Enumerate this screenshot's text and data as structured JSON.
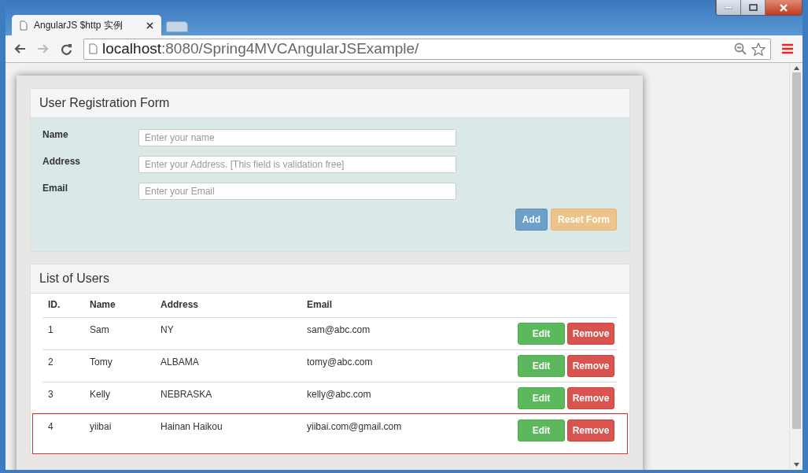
{
  "browser": {
    "tab_title": "AngularJS $http 实例",
    "address_host": "localhost",
    "address_path": ":8080/Spring4MVCAngularJSExample/"
  },
  "form": {
    "title": "User Registration Form",
    "fields": [
      {
        "label": "Name",
        "placeholder": "Enter your name"
      },
      {
        "label": "Address",
        "placeholder": "Enter your Address. [This field is validation free]"
      },
      {
        "label": "Email",
        "placeholder": "Enter your Email"
      }
    ],
    "buttons": [
      {
        "label": "Add",
        "kind": "primary"
      },
      {
        "label": "Reset Form",
        "kind": "warning"
      }
    ]
  },
  "users": {
    "title": "List of Users",
    "columns": [
      "ID.",
      "Name",
      "Address",
      "Email"
    ],
    "rows": [
      {
        "cells": [
          "1",
          "Sam",
          "NY",
          "sam@abc.com"
        ],
        "highlighted": false,
        "actions": [
          "Edit",
          "Remove"
        ]
      },
      {
        "cells": [
          "2",
          "Tomy",
          "ALBAMA",
          "tomy@abc.com"
        ],
        "highlighted": false,
        "actions": [
          "Edit",
          "Remove"
        ]
      },
      {
        "cells": [
          "3",
          "Kelly",
          "NEBRASKA",
          "kelly@abc.com"
        ],
        "highlighted": false,
        "actions": [
          "Edit",
          "Remove"
        ]
      },
      {
        "cells": [
          "4",
          "yiibai",
          "Hainan Haikou",
          "yiibai.com@gmail.com"
        ],
        "highlighted": true,
        "actions": [
          "Edit",
          "Remove"
        ]
      }
    ]
  }
}
